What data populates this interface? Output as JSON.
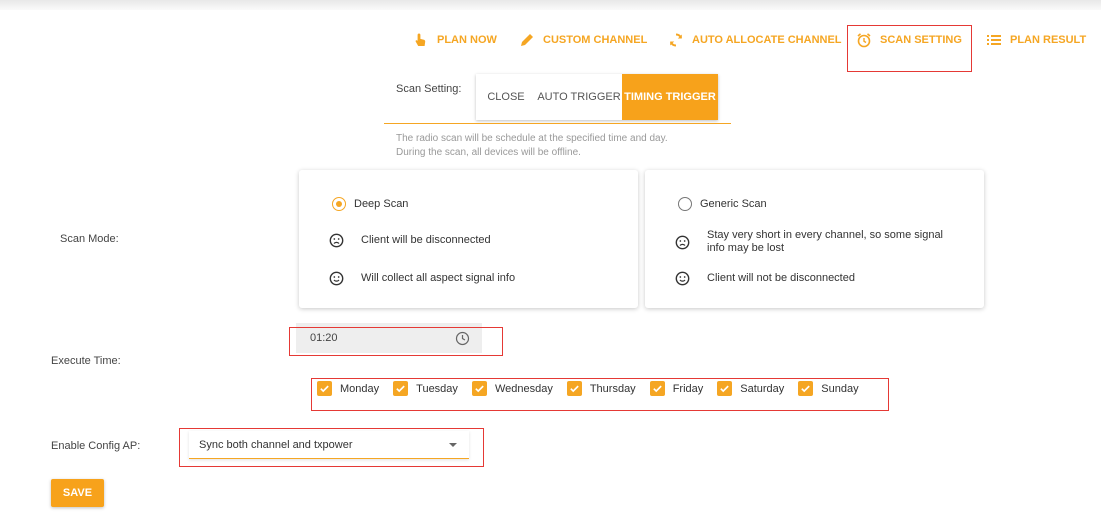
{
  "colors": {
    "accent": "#f5a623",
    "highlight_box": "#e53935"
  },
  "nav": {
    "items": [
      {
        "label": "PLAN NOW",
        "icon": "hand-pointer-icon"
      },
      {
        "label": "CUSTOM CHANNEL",
        "icon": "pencil-icon"
      },
      {
        "label": "AUTO ALLOCATE CHANNEL",
        "icon": "refresh-icon"
      },
      {
        "label": "SCAN SETTING",
        "icon": "alarm-clock-icon"
      },
      {
        "label": "PLAN RESULT",
        "icon": "list-icon"
      }
    ],
    "active": "SCAN SETTING"
  },
  "scan_setting": {
    "label": "Scan Setting:",
    "options": {
      "close": "CLOSE",
      "auto": "AUTO TRIGGER",
      "timing": "TIMING TRIGGER"
    },
    "selected": "TIMING TRIGGER",
    "hint_line1": "The radio scan will be schedule at the specified time and day.",
    "hint_line2": "During the scan, all devices will be offline."
  },
  "scan_mode": {
    "label": "Scan Mode:",
    "deep": {
      "title": "Deep Scan",
      "selected": true,
      "con": "Client will be disconnected",
      "pro": "Will collect all aspect signal info"
    },
    "generic": {
      "title": "Generic Scan",
      "selected": false,
      "con": "Stay very short in every channel, so some signal info may be lost",
      "pro": "Client will not be disconnected"
    }
  },
  "execute_time": {
    "label": "Execute Time:",
    "time": "01:20",
    "days": [
      {
        "label": "Monday",
        "checked": true
      },
      {
        "label": "Tuesday",
        "checked": true
      },
      {
        "label": "Wednesday",
        "checked": true
      },
      {
        "label": "Thursday",
        "checked": true
      },
      {
        "label": "Friday",
        "checked": true
      },
      {
        "label": "Saturday",
        "checked": true
      },
      {
        "label": "Sunday",
        "checked": true
      }
    ]
  },
  "config_ap": {
    "label": "Enable Config AP:",
    "selected": "Sync both channel and txpower"
  },
  "save_label": "SAVE"
}
